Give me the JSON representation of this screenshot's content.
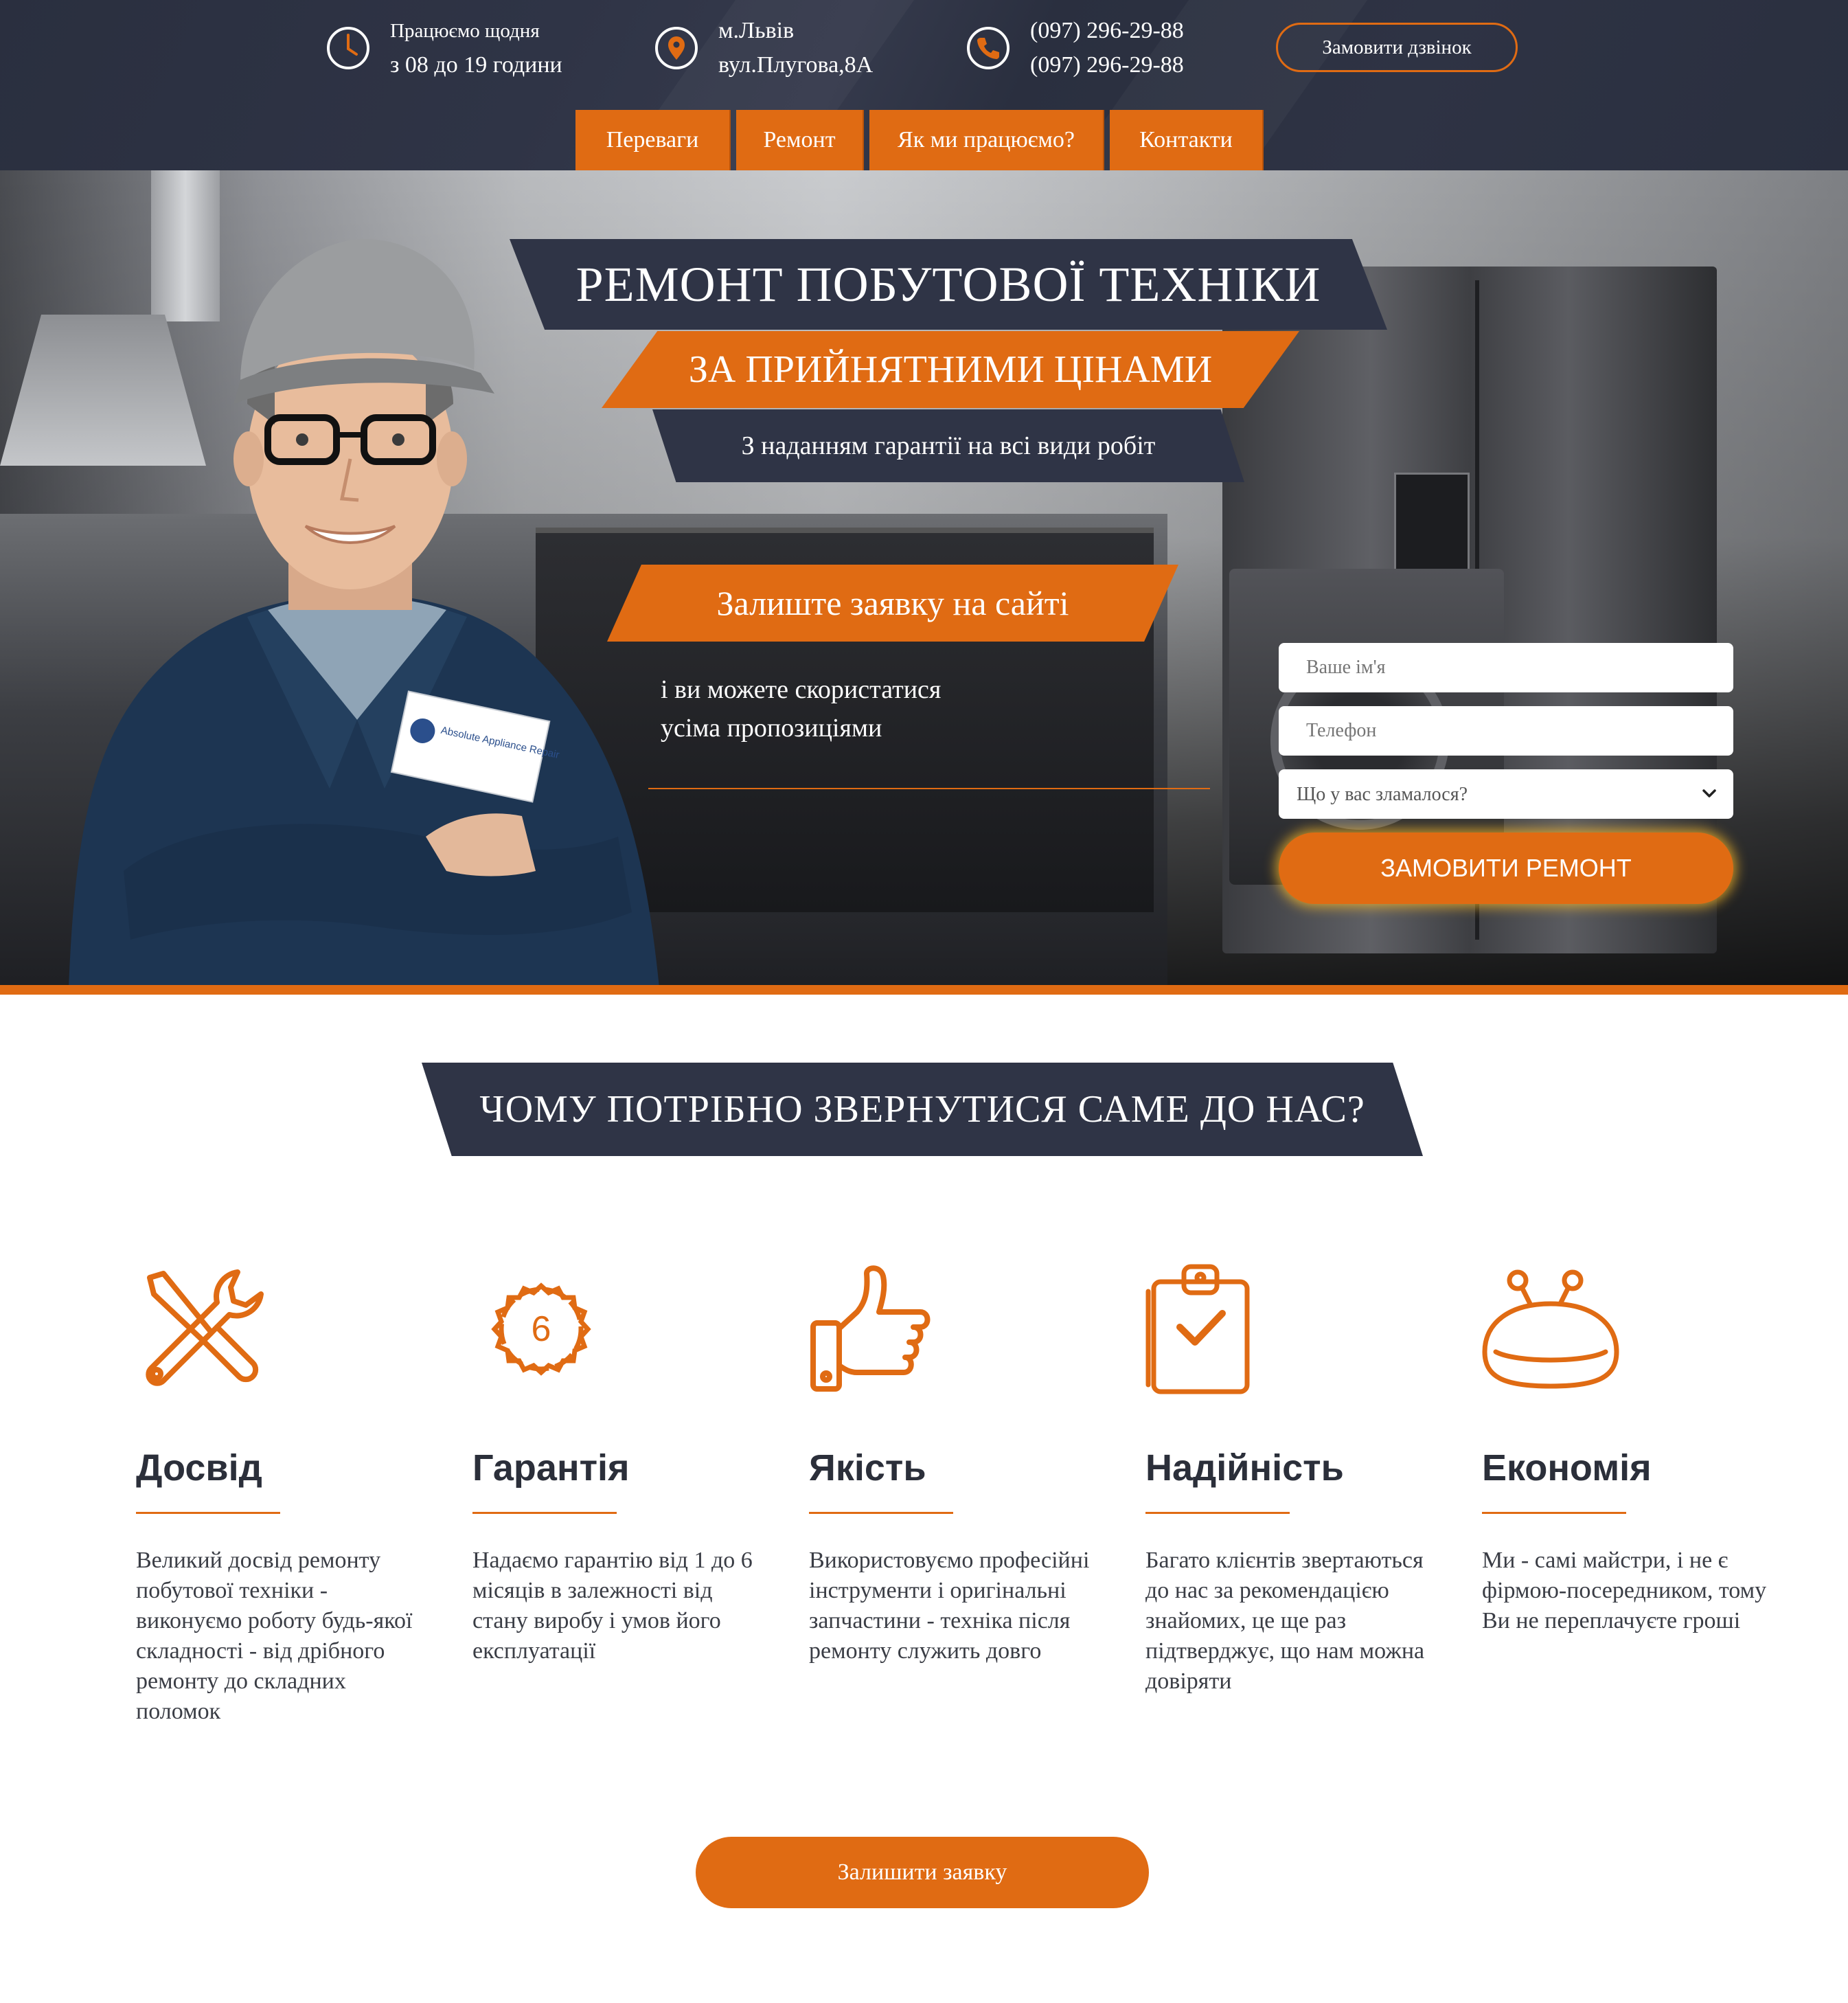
{
  "header": {
    "schedule_line1": "Працюємо щодня",
    "schedule_line2": "з 08 до 19 години",
    "city": "м.Львів",
    "street": "вул.Плугова,8А",
    "phone1": "(097) 296-29-88",
    "phone2": "(097) 296-29-88",
    "callback_label": "Замовити дзвінок"
  },
  "nav": {
    "items": [
      {
        "label": "Переваги"
      },
      {
        "label": "Ремонт"
      },
      {
        "label": "Як ми працюємо?"
      },
      {
        "label": "Контакти"
      }
    ]
  },
  "hero": {
    "title": "РЕМОНТ ПОБУТОВОЇ ТЕХНІКИ",
    "subtitle": "ЗА ПРИЙНЯТНИМИ ЦІНАМИ",
    "tagline": "З наданням гарантії на всі види робіт",
    "cta_title": "Залиште заявку на сайті",
    "cta_line1": "і ви можете скористатися",
    "cta_line2": "усіма пропозиціями",
    "badge_text": "Absolute Appliance Repair"
  },
  "form": {
    "name_placeholder": "Ваше ім'я",
    "phone_placeholder": "Телефон",
    "select_value": "Що у вас зламалося?",
    "submit_label": "ЗАМОВИТИ РЕМОНТ"
  },
  "why": {
    "title": "ЧОМУ ПОТРІБНО ЗВЕРНУТИСЯ САМЕ ДО НАС?",
    "features": [
      {
        "icon": "tools-icon",
        "title": "Досвід",
        "text": "Великий досвід ремонту побутової техніки - виконуємо роботу будь-якої складності - від дрібного ремонту до складних поломок"
      },
      {
        "icon": "warranty-badge-icon",
        "badge_number": "6",
        "title": "Гарантія",
        "text": "Надаємо гарантію від 1 до 6 місяців в залежності від стану виробу і умов його експлуатації"
      },
      {
        "icon": "thumbs-up-icon",
        "title": "Якість",
        "text": "Використовуємо професійні інструменти і оригінальні запчастини - техніка після ремонту служить довго"
      },
      {
        "icon": "clipboard-check-icon",
        "title": "Надійність",
        "text": "Багато клієнтів звертаються до нас за рекомендацією знайомих, це ще раз підтверджує, що нам можна довіряти"
      },
      {
        "icon": "wallet-icon",
        "title": "Економія",
        "text": "Ми - самі майстри, і не є фірмою-посередником, тому Ви не переплачуєте гроші"
      }
    ],
    "leave_request_label": "Залишити заявку"
  },
  "colors": {
    "accent": "#e06b13",
    "dark": "#2f3446",
    "text": "#2b2f3a"
  }
}
